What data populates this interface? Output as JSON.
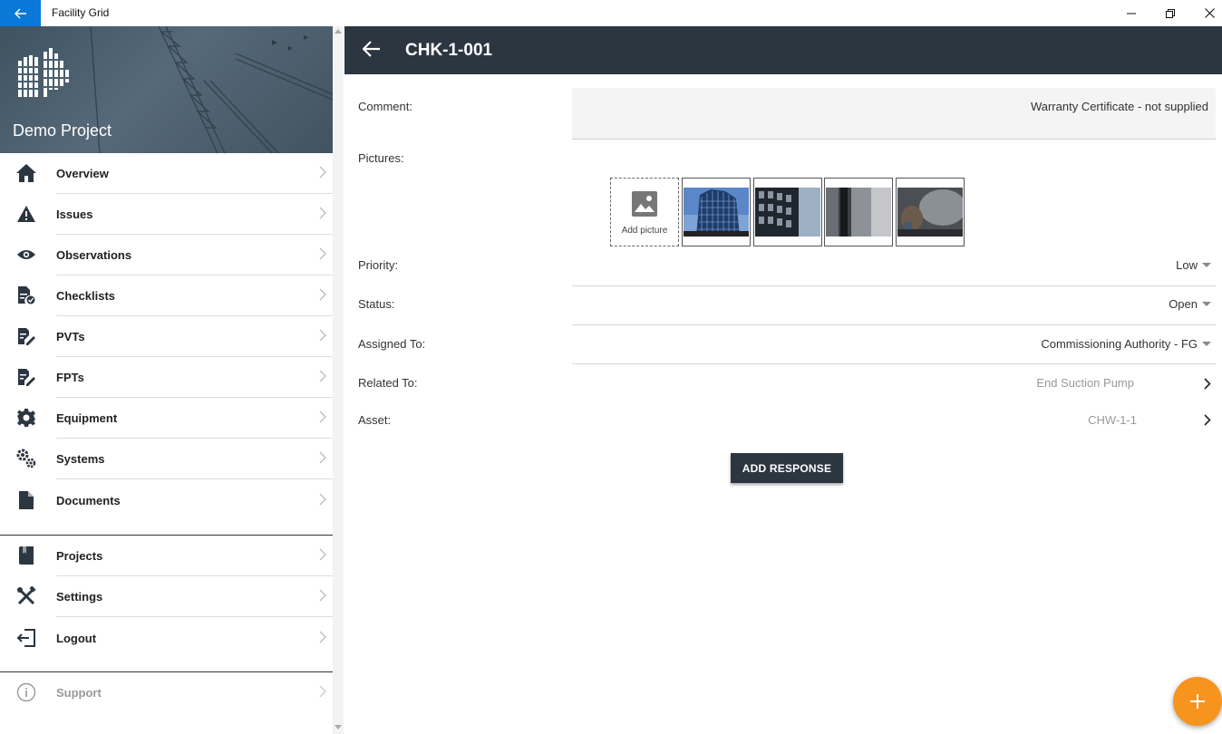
{
  "window": {
    "title": "Facility Grid",
    "accent": "#0a78d7"
  },
  "sidebar": {
    "project_name": "Demo Project",
    "items": [
      {
        "label": "Overview",
        "icon": "home-icon"
      },
      {
        "label": "Issues",
        "icon": "warning-icon"
      },
      {
        "label": "Observations",
        "icon": "eye-icon"
      },
      {
        "label": "Checklists",
        "icon": "checklist-icon"
      },
      {
        "label": "PVTs",
        "icon": "pvt-icon"
      },
      {
        "label": "FPTs",
        "icon": "fpt-icon"
      },
      {
        "label": "Equipment",
        "icon": "gear-icon"
      },
      {
        "label": "Systems",
        "icon": "gears-icon"
      },
      {
        "label": "Documents",
        "icon": "document-icon"
      }
    ],
    "secondary": [
      {
        "label": "Projects",
        "icon": "book-icon"
      },
      {
        "label": "Settings",
        "icon": "tools-icon"
      },
      {
        "label": "Logout",
        "icon": "logout-icon"
      }
    ],
    "support": {
      "label": "Support",
      "icon": "info-icon"
    }
  },
  "detail": {
    "title": "CHK-1-001",
    "comment_label": "Comment:",
    "comment_value": "Warranty Certificate - not supplied",
    "pictures_label": "Pictures:",
    "add_picture_label": "Add picture",
    "priority_label": "Priority:",
    "priority_value": "Low",
    "status_label": "Status:",
    "status_value": "Open",
    "assigned_label": "Assigned To:",
    "assigned_value": "Commissioning Authority - FG",
    "related_label": "Related To:",
    "related_value": "End Suction Pump",
    "asset_label": "Asset:",
    "asset_value": "CHW-1-1",
    "add_response_label": "ADD RESPONSE"
  },
  "colors": {
    "header_dark": "#2b3641",
    "fab": "#f7941d"
  }
}
